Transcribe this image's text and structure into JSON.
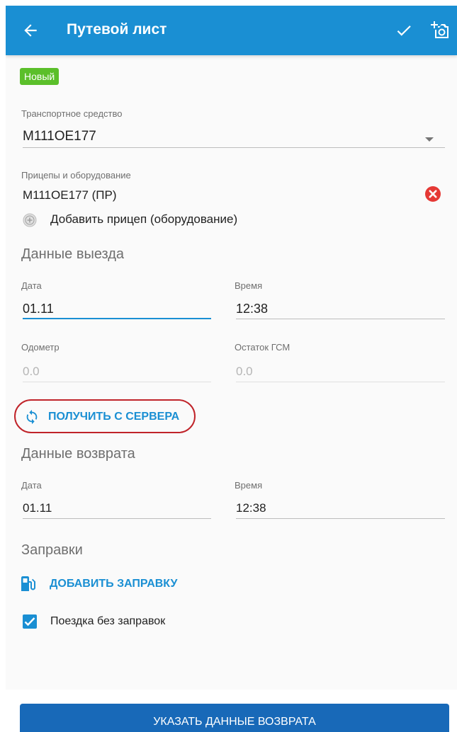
{
  "appbar": {
    "title": "Путевой лист",
    "back_icon": "arrow-left-icon",
    "confirm_icon": "check-icon",
    "camera_icon": "add-photo-icon"
  },
  "status_badge": "Новый",
  "vehicle": {
    "label": "Транспортное средство",
    "value": "М111ОЕ177"
  },
  "trailers": {
    "label": "Прицепы и оборудование",
    "items": [
      "М111ОЕ177 (ПР)"
    ],
    "add_label": "Добавить прицеп (оборудование)"
  },
  "departure": {
    "section_title": "Данные выезда",
    "date_label": "Дата",
    "date_value": "01.11",
    "time_label": "Время",
    "time_value": "12:38",
    "odometer_label": "Одометр",
    "odometer_value": "0.0",
    "fuel_label": "Остаток ГСМ",
    "fuel_value": "0.0",
    "server_button": "ПОЛУЧИТЬ С СЕРВЕРА"
  },
  "return": {
    "section_title": "Данные возврата",
    "date_label": "Дата",
    "date_value": "01.11",
    "time_label": "Время",
    "time_value": "12:38"
  },
  "refuels": {
    "section_title": "Заправки",
    "add_button": "ДОБАВИТЬ ЗАПРАВКУ",
    "no_refuel_label": "Поездка без заправок",
    "no_refuel_checked": true
  },
  "primary_button": "УКАЗАТЬ ДАННЫЕ ВОЗВРАТА",
  "colors": {
    "appbar": "#1a8fd3",
    "accent": "#1a8fd3",
    "badge": "#5bbf2a",
    "highlight": "#c0242a",
    "remove": "#e53935",
    "primary_button": "#1869b8"
  }
}
